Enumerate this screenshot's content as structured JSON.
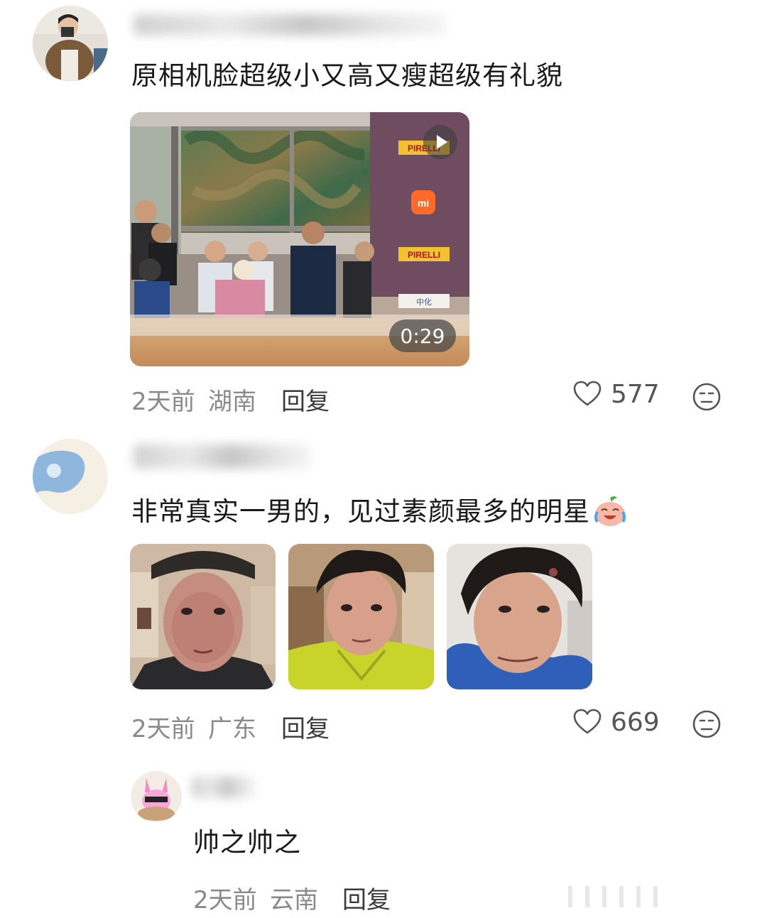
{
  "comments": [
    {
      "text": "原相机脸超级小又高又瘦超级有礼貌",
      "time": "2天前",
      "location": "湖南",
      "reply_label": "回复",
      "likes": "577",
      "video_duration": "0:29",
      "video_brand_1": "PIRELLI",
      "video_brand_2": "mi",
      "video_brand_3": "PIRELLI",
      "video_brand_4": "中化"
    },
    {
      "text": "非常真实一男的，见过素颜最多的明星",
      "emoji": "crying-laughing-peach-emoji",
      "time": "2天前",
      "location": "广东",
      "reply_label": "回复",
      "likes": "669"
    }
  ],
  "reply": {
    "text": "帅之帅之",
    "time": "2天前",
    "location": "云南",
    "reply_label": "回复"
  },
  "colors": {
    "meta_gray": "#8a8a8a",
    "icon_gray": "#555555",
    "video_purple": "#6f4c60",
    "pirelli_yellow": "#f2c230",
    "mi_orange": "#ff6a2b"
  }
}
